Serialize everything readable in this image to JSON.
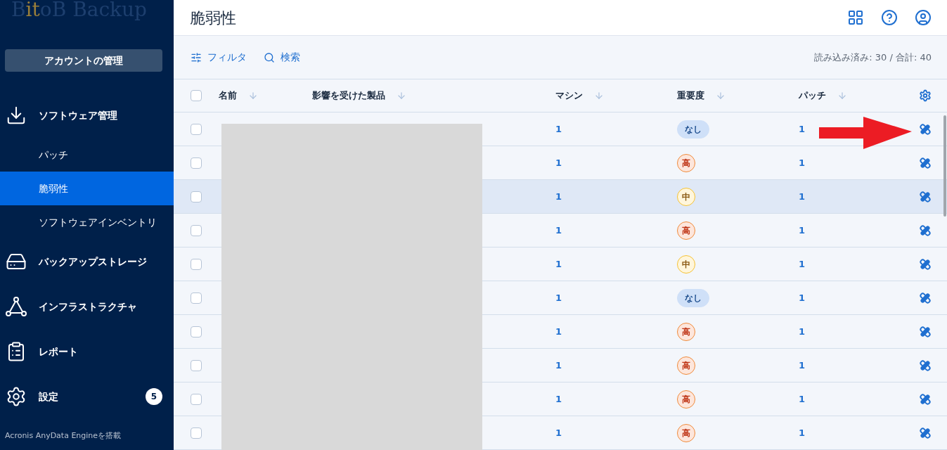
{
  "logo": {
    "text_1": "B",
    "accent": "it",
    "text_2": "oB Backup"
  },
  "sidebar": {
    "account_button": "アカウントの管理",
    "items": [
      {
        "label": "ソフトウェア管理",
        "selected": false,
        "children": [
          {
            "label": "パッチ",
            "selected": false
          },
          {
            "label": "脆弱性",
            "selected": true
          },
          {
            "label": "ソフトウェアインベントリ",
            "selected": false
          }
        ]
      },
      {
        "label": "バックアップストレージ",
        "selected": false
      },
      {
        "label": "インフラストラクチャ",
        "selected": false
      },
      {
        "label": "レポート",
        "selected": false
      },
      {
        "label": "設定",
        "selected": false,
        "badge": "5"
      }
    ],
    "footer": "Acronis AnyData Engineを搭載"
  },
  "page": {
    "title": "脆弱性"
  },
  "toolbar": {
    "filter": "フィルタ",
    "search": "検索",
    "count": "読み込み済み: 30 / 合計: 40"
  },
  "table": {
    "select_all": {
      "checked": false
    },
    "columns": [
      "名前",
      "影響を受けた製品",
      "マシン",
      "重要度",
      "パッチ"
    ],
    "rows": [
      {
        "selected": false,
        "checked": false,
        "machines": "1",
        "severity": {
          "kind": "none",
          "label": "なし"
        },
        "patches": "1"
      },
      {
        "selected": false,
        "checked": false,
        "machines": "1",
        "severity": {
          "kind": "high",
          "label": "高"
        },
        "patches": "1"
      },
      {
        "selected": true,
        "checked": false,
        "machines": "1",
        "severity": {
          "kind": "medium",
          "label": "中"
        },
        "patches": "1"
      },
      {
        "selected": false,
        "checked": false,
        "machines": "1",
        "severity": {
          "kind": "high",
          "label": "高"
        },
        "patches": "1"
      },
      {
        "selected": false,
        "checked": false,
        "machines": "1",
        "severity": {
          "kind": "medium",
          "label": "中"
        },
        "patches": "1"
      },
      {
        "selected": false,
        "checked": false,
        "machines": "1",
        "severity": {
          "kind": "none",
          "label": "なし"
        },
        "patches": "1"
      },
      {
        "selected": false,
        "checked": false,
        "machines": "1",
        "severity": {
          "kind": "high",
          "label": "高"
        },
        "patches": "1"
      },
      {
        "selected": false,
        "checked": false,
        "machines": "1",
        "severity": {
          "kind": "high",
          "label": "高"
        },
        "patches": "1"
      },
      {
        "selected": false,
        "checked": false,
        "machines": "1",
        "severity": {
          "kind": "high",
          "label": "高"
        },
        "patches": "1"
      },
      {
        "selected": false,
        "checked": false,
        "machines": "1",
        "severity": {
          "kind": "high",
          "label": "高"
        },
        "patches": "1"
      }
    ]
  }
}
